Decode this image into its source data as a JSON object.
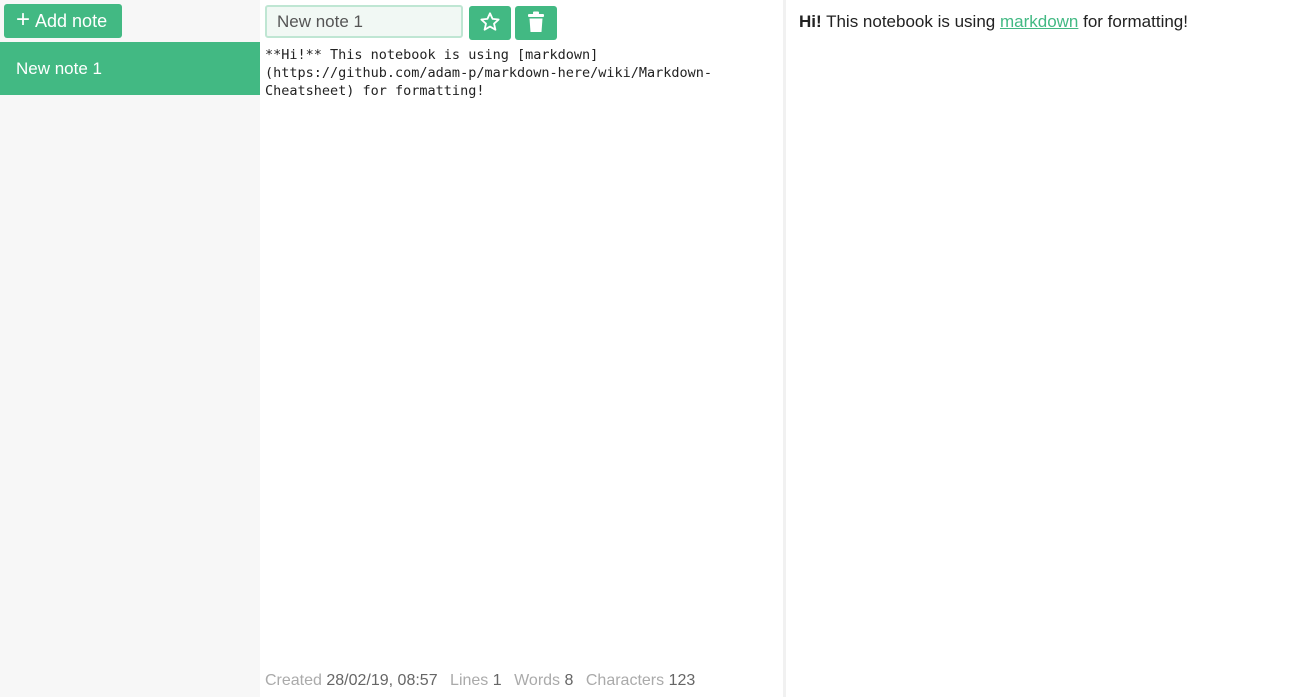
{
  "sidebar": {
    "add_button_icon": "+",
    "add_button_label": "Add note",
    "notes": [
      {
        "title": "New note 1",
        "selected": true
      }
    ]
  },
  "editor": {
    "title_value": "New note 1",
    "star_button_icon": "star-icon",
    "delete_button_icon": "trash-icon",
    "content": "**Hi!** This notebook is using [markdown]\n(https://github.com/adam-p/markdown-here/wiki/Markdown-\nCheatsheet) for formatting!",
    "stats": {
      "created_label": "Created",
      "created_value": "28/02/19, 08:57",
      "lines_label": "Lines",
      "lines_value": "1",
      "words_label": "Words",
      "words_value": "8",
      "characters_label": "Characters",
      "characters_value": "123"
    }
  },
  "preview": {
    "bold_text": "Hi!",
    "text_before_link": " This notebook is using ",
    "link_text": "markdown",
    "text_after_link": " for formatting!"
  },
  "colors": {
    "accent": "#42b983",
    "sidebar_bg": "#f7f7f7",
    "title_input_bg": "#f1f8f4",
    "muted_text": "#aaaaaa"
  }
}
